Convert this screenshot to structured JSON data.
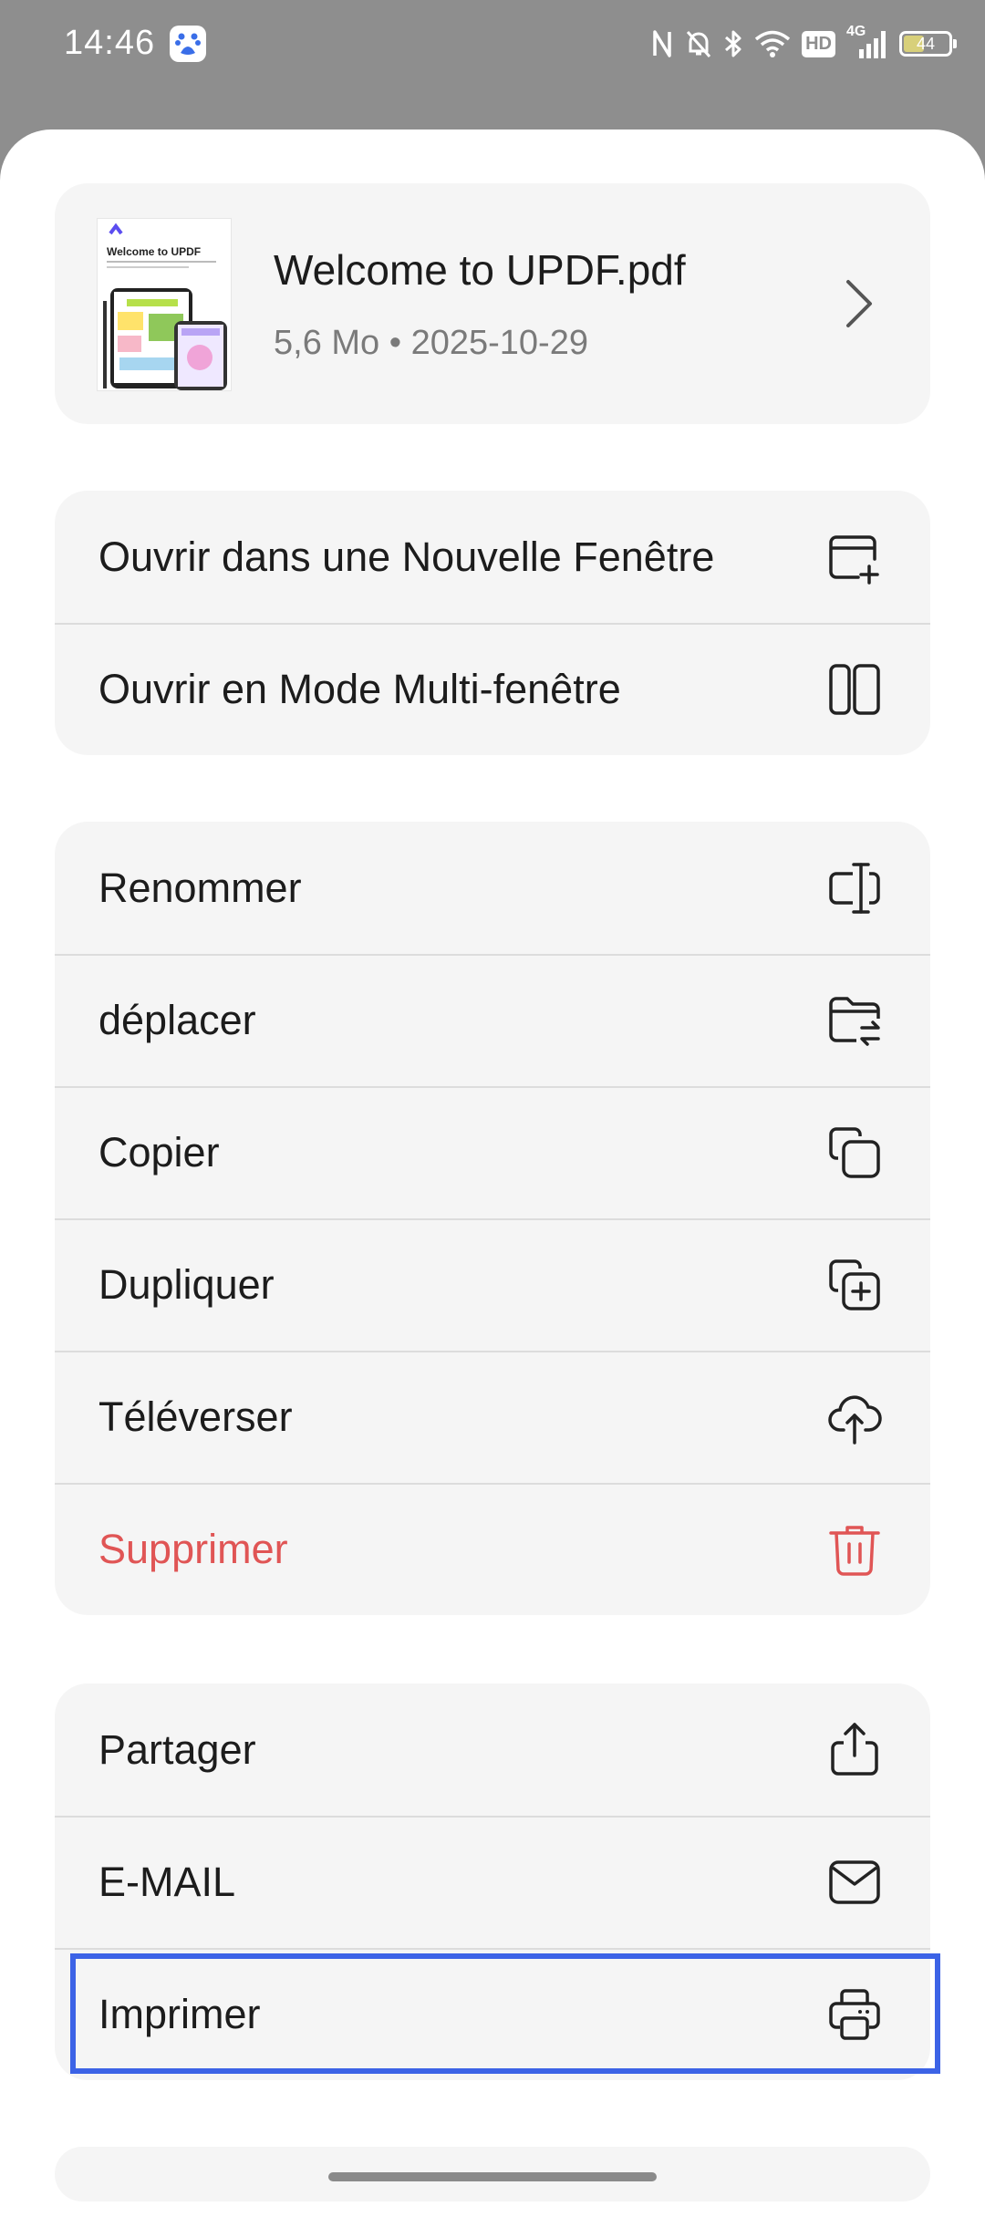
{
  "status_bar": {
    "time": "14:46",
    "network": "4G",
    "hd_badge": "HD",
    "battery": "44"
  },
  "file": {
    "thumbnail_title": "Welcome to UPDF",
    "name": "Welcome to UPDF.pdf",
    "meta": "5,6 Mo • 2025-10-29"
  },
  "groups": {
    "window": [
      {
        "label": "Ouvrir dans une Nouvelle Fenêtre",
        "icon": "new-window-icon"
      },
      {
        "label": "Ouvrir en Mode Multi-fenêtre",
        "icon": "split-window-icon"
      }
    ],
    "file_ops": [
      {
        "label": "Renommer",
        "icon": "rename-icon"
      },
      {
        "label": "déplacer",
        "icon": "move-folder-icon"
      },
      {
        "label": "Copier",
        "icon": "copy-icon"
      },
      {
        "label": "Dupliquer",
        "icon": "duplicate-icon"
      },
      {
        "label": "Téléverser",
        "icon": "cloud-upload-icon"
      },
      {
        "label": "Supprimer",
        "icon": "trash-icon",
        "color": "#e05555"
      }
    ],
    "share": [
      {
        "label": "Partager",
        "icon": "share-icon"
      },
      {
        "label": "E-MAIL",
        "icon": "mail-icon"
      },
      {
        "label": "Imprimer",
        "icon": "printer-icon"
      }
    ]
  },
  "colors": {
    "danger": "#e05555",
    "highlight": "#3c63e6"
  }
}
